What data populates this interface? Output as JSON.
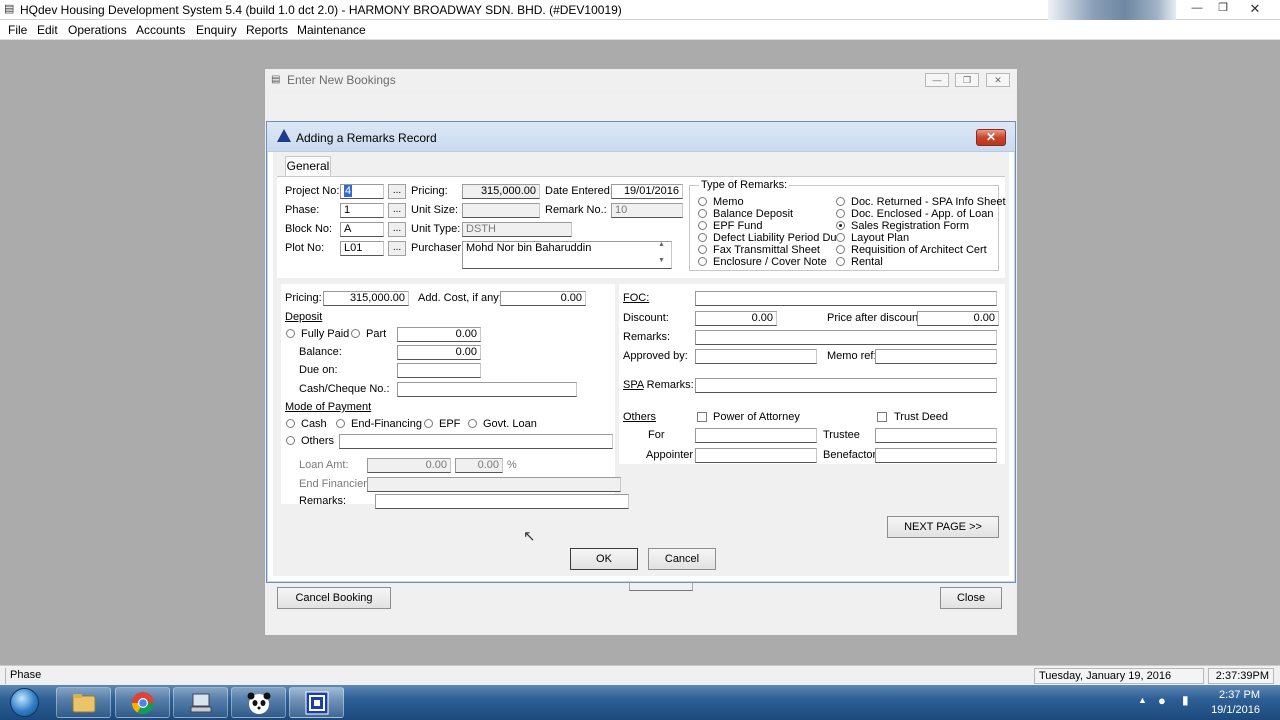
{
  "app": {
    "title": "HQdev Housing Development System 5.4 (build 1.0 dct 2.0) - HARMONY BROADWAY SDN. BHD. (#DEV10019)",
    "menu": [
      "File",
      "Edit",
      "Operations",
      "Accounts",
      "Enquiry",
      "Reports",
      "Maintenance"
    ]
  },
  "bookings_window": {
    "title": "Enter New Bookings",
    "cancel_booking": "Cancel Booking",
    "close": "Close"
  },
  "dialog": {
    "title": "Adding a Remarks Record",
    "tab": "General",
    "header": {
      "project_no_label": "Project No:",
      "project_no": "4",
      "phase_label": "Phase:",
      "phase": "1",
      "block_no_label": "Block No:",
      "block_no": "A",
      "plot_no_label": "Plot No:",
      "plot_no": "L01",
      "browse": "...",
      "pricing_label": "Pricing:",
      "pricing": "315,000.00",
      "unit_size_label": "Unit Size:",
      "unit_size": "",
      "unit_type_label": "Unit Type:",
      "unit_type": "DSTH",
      "purchaser_label": "Purchaser:",
      "purchaser": "Mohd Nor bin Baharuddin",
      "date_entered_label": "Date Entered:",
      "date_entered": "19/01/2016",
      "remark_no_label": "Remark No.:",
      "remark_no": "10"
    },
    "type_of_remarks": {
      "label": "Type of Remarks:",
      "left": [
        "Memo",
        "Balance Deposit",
        "EPF Fund",
        "Defect Liability Period Due",
        "Fax Transmittal Sheet",
        "Enclosure / Cover Note"
      ],
      "right": [
        "Doc. Returned - SPA Info Sheet",
        "Doc. Enclosed - App. of Loan",
        "Sales Registration Form",
        "Layout Plan",
        "Requisition of Architect Cert",
        "Rental"
      ],
      "selected": "Sales Registration Form"
    },
    "left_panel": {
      "pricing_label": "Pricing:",
      "pricing": "315,000.00",
      "add_cost_label": "Add. Cost, if any:",
      "add_cost": "0.00",
      "deposit_label": "Deposit",
      "fully_paid": "Fully Paid",
      "part": "Part",
      "deposit_amount": "0.00",
      "balance_label": "Balance:",
      "balance": "0.00",
      "due_on_label": "Due on:",
      "due_on": "",
      "cheque_label": "Cash/Cheque No.:",
      "cheque": "",
      "mode_label": "Mode of Payment",
      "cash": "Cash",
      "end_financing": "End-Financing",
      "epf": "EPF",
      "govt_loan": "Govt. Loan",
      "others": "Others",
      "loan_amt_label": "Loan Amt:",
      "loan_amt": "0.00",
      "loan_pct": "0.00",
      "pct_sign": "%",
      "end_financier_label": "End Financier:",
      "end_financier": "",
      "remarks_label": "Remarks:",
      "remarks": ""
    },
    "right_panel": {
      "foc_label": "FOC:",
      "foc": "",
      "discount_label": "Discount:",
      "discount": "0.00",
      "price_after_label": "Price after discount:",
      "price_after": "0.00",
      "remarks_label": "Remarks:",
      "remarks": "",
      "approved_label": "Approved by:",
      "approved": "",
      "memo_ref_label": "Memo ref:",
      "memo_ref": "",
      "spa_remarks_label": "SPA Remarks:",
      "spa_remarks": "",
      "others_label": "Others",
      "power_of_attorney": "Power of Attorney",
      "trust_deed": "Trust Deed",
      "for_label": "For",
      "trustee_label": "Trustee",
      "appointer_label": "Appointer",
      "benefactor_label": "Benefactor"
    },
    "next_page": "NEXT PAGE >>",
    "ok": "OK",
    "cancel": "Cancel"
  },
  "status_bar": {
    "field": "Phase",
    "date": "Tuesday, January 19, 2016",
    "time": "2:37:39PM"
  },
  "taskbar": {
    "clock_time": "2:37 PM",
    "clock_date": "19/1/2016"
  },
  "colors": {
    "taskbar": "#2d5f95",
    "dialog_title": "#c9daf0",
    "close_red": "#c8452c",
    "selection": "#3167d8"
  }
}
